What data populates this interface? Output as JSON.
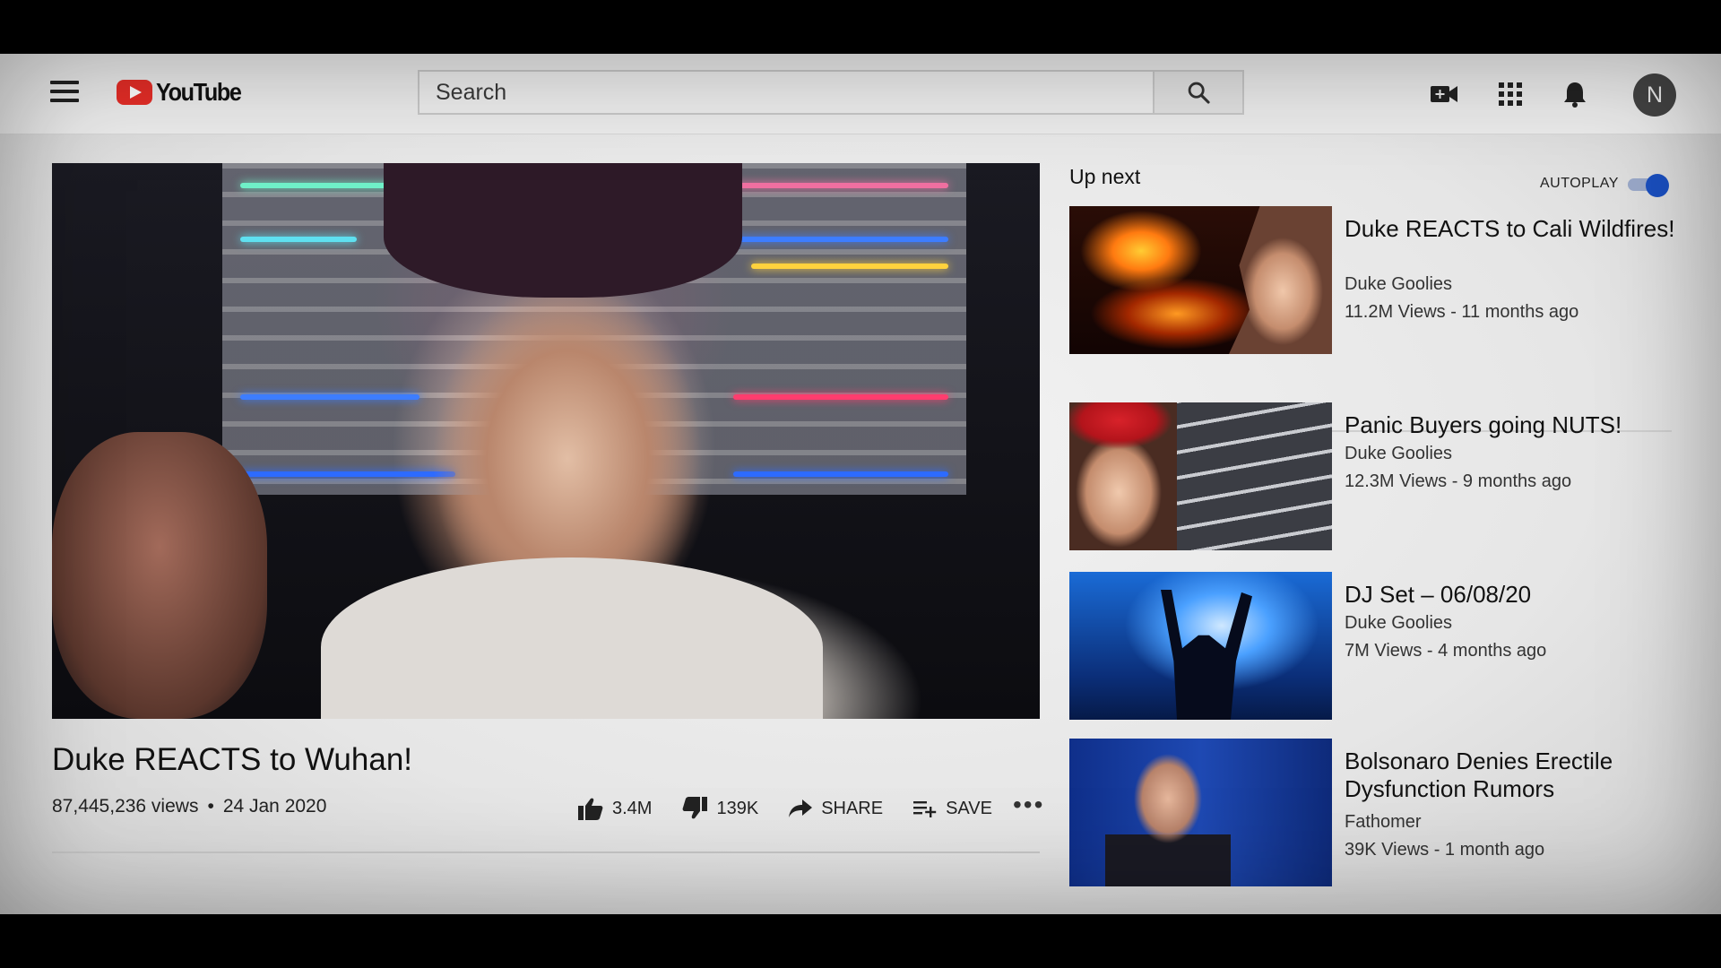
{
  "header": {
    "logo_text": "YouTube",
    "search_placeholder": "Search",
    "avatar_letter": "N"
  },
  "video": {
    "title": "Duke REACTS to Wuhan!",
    "views": "87,445,236 views",
    "separator": "•",
    "date": "24 Jan 2020",
    "likes": "3.4M",
    "dislikes": "139K",
    "share_label": "SHARE",
    "save_label": "SAVE",
    "more": "•••"
  },
  "sidebar": {
    "up_next": "Up next",
    "autoplay_label": "AUTOPLAY",
    "autoplay_on": true,
    "items": [
      {
        "title": "Duke REACTS to Cali Wildfires!",
        "channel": "Duke Goolies",
        "stats": "11.2M Views - 11 months ago"
      },
      {
        "title": "Panic Buyers going NUTS!",
        "channel": "Duke Goolies",
        "stats": "12.3M Views - 9 months ago"
      },
      {
        "title": "DJ Set – 06/08/20",
        "channel": "Duke Goolies",
        "stats": "7M Views - 4 months ago"
      },
      {
        "title": "Bolsonaro Denies Erectile Dysfunction Rumors",
        "channel": "Fathomer",
        "stats": "39K Views - 1 month ago"
      }
    ]
  },
  "colors": {
    "brand_red": "#e52d27",
    "toggle_blue": "#1a4fbf"
  }
}
